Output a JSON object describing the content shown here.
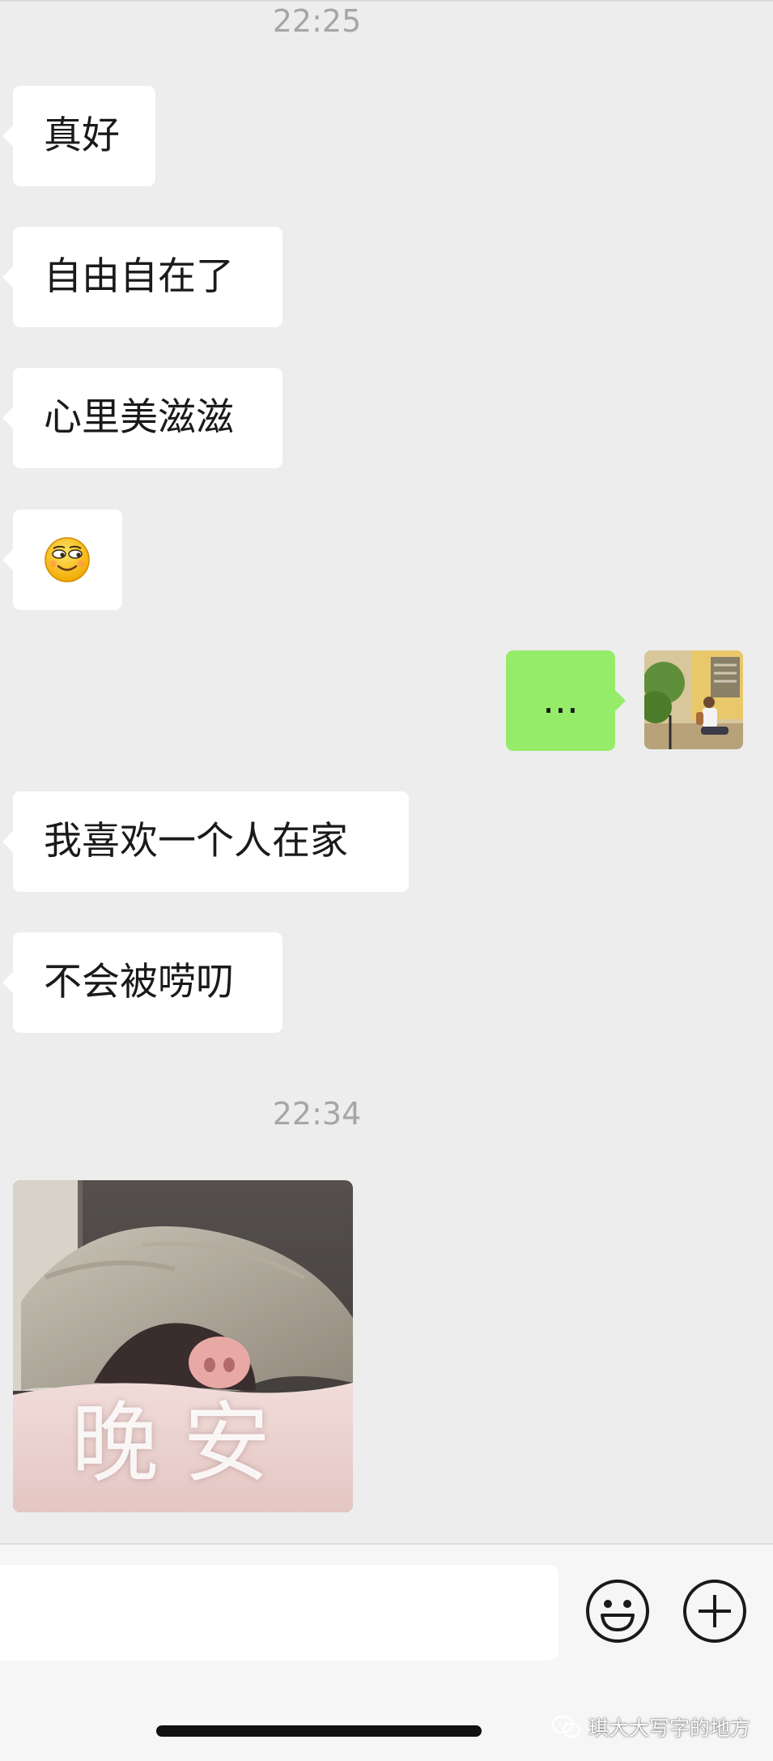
{
  "chat": {
    "timestamps": [
      "22:25",
      "22:34"
    ],
    "messages": [
      {
        "sender": "contact",
        "text": "真好"
      },
      {
        "sender": "contact",
        "text": "自由自在了"
      },
      {
        "sender": "contact",
        "text": "心里美滋滋"
      },
      {
        "sender": "contact",
        "type": "emoji",
        "icon": "smirk-emoji-icon"
      },
      {
        "sender": "me",
        "text": "..."
      },
      {
        "sender": "contact",
        "text": "我喜欢一个人在家"
      },
      {
        "sender": "contact",
        "text": "不会被唠叨"
      },
      {
        "sender": "contact",
        "type": "sticker",
        "text": "晚安",
        "icon": "pig-under-blanket-sticker"
      }
    ]
  },
  "input_bar": {
    "placeholder": "",
    "value": "",
    "icons": [
      "emoji-icon",
      "plus-icon"
    ]
  },
  "watermark": {
    "text": "琪大大写字的地方",
    "icon": "wechat-icon"
  },
  "colors": {
    "background": "#ededed",
    "incoming_bubble": "#ffffff",
    "outgoing_bubble": "#95ec69",
    "timestamp": "#a6a6a6"
  }
}
